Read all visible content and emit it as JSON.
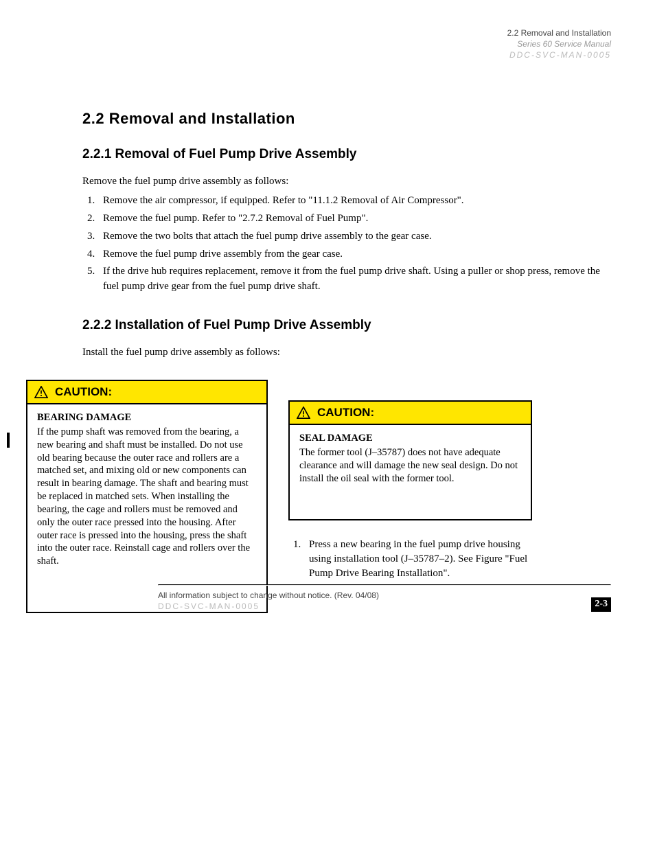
{
  "header": {
    "line1": "2.2 Removal and Installation",
    "line2": "Series 60 Service Manual",
    "line3": "DDC-SVC-MAN-0005"
  },
  "title": "2.2 Removal and Installation",
  "section1": {
    "heading": "2.2.1 Removal of Fuel Pump Drive Assembly",
    "intro": "Remove the fuel pump drive assembly as follows:",
    "steps": [
      "Remove the air compressor, if equipped. Refer to \"11.1.2 Removal of Air Compressor\".",
      "Remove the fuel pump. Refer to \"2.7.2 Removal of Fuel Pump\".",
      "Remove the two bolts that attach the fuel pump drive assembly to the gear case.",
      "Remove the fuel pump drive assembly from the gear case.",
      "If the drive hub requires replacement, remove it from the fuel pump drive shaft. Using a puller or shop press, remove the fuel pump drive gear from the fuel pump drive shaft."
    ]
  },
  "section2": {
    "heading": "2.2.2 Installation of Fuel Pump Drive Assembly",
    "intro": "Install the fuel pump drive assembly as follows:",
    "caution1": {
      "label": "CAUTION:",
      "title": "BEARING DAMAGE",
      "body": "If the pump shaft was removed from the bearing, a new bearing and shaft must be installed. Do not use old bearing because the outer race and rollers are a matched set, and mixing old or new components can result in bearing damage. The shaft and bearing must be replaced in matched sets. When installing the bearing, the cage and rollers must be removed and only the outer race pressed into the housing. After outer race is pressed into the housing, press the shaft into the outer race. Reinstall cage and rollers over the shaft."
    },
    "caution2": {
      "label": "CAUTION:",
      "title": "SEAL DAMAGE",
      "body": "The former tool (J–35787) does not have adequate clearance and will damage the new seal design. Do not install the oil seal with the former tool."
    },
    "final_step_start": 1,
    "final_step": "Press a new bearing in the fuel pump drive housing using installation tool (J–35787–2). See Figure \"Fuel Pump Drive Bearing Installation\"."
  },
  "footer": {
    "copyright": "All information subject to change without notice. (Rev. 04/08)",
    "manualcode": "DDC-SVC-MAN-0005",
    "page": "2-3"
  }
}
